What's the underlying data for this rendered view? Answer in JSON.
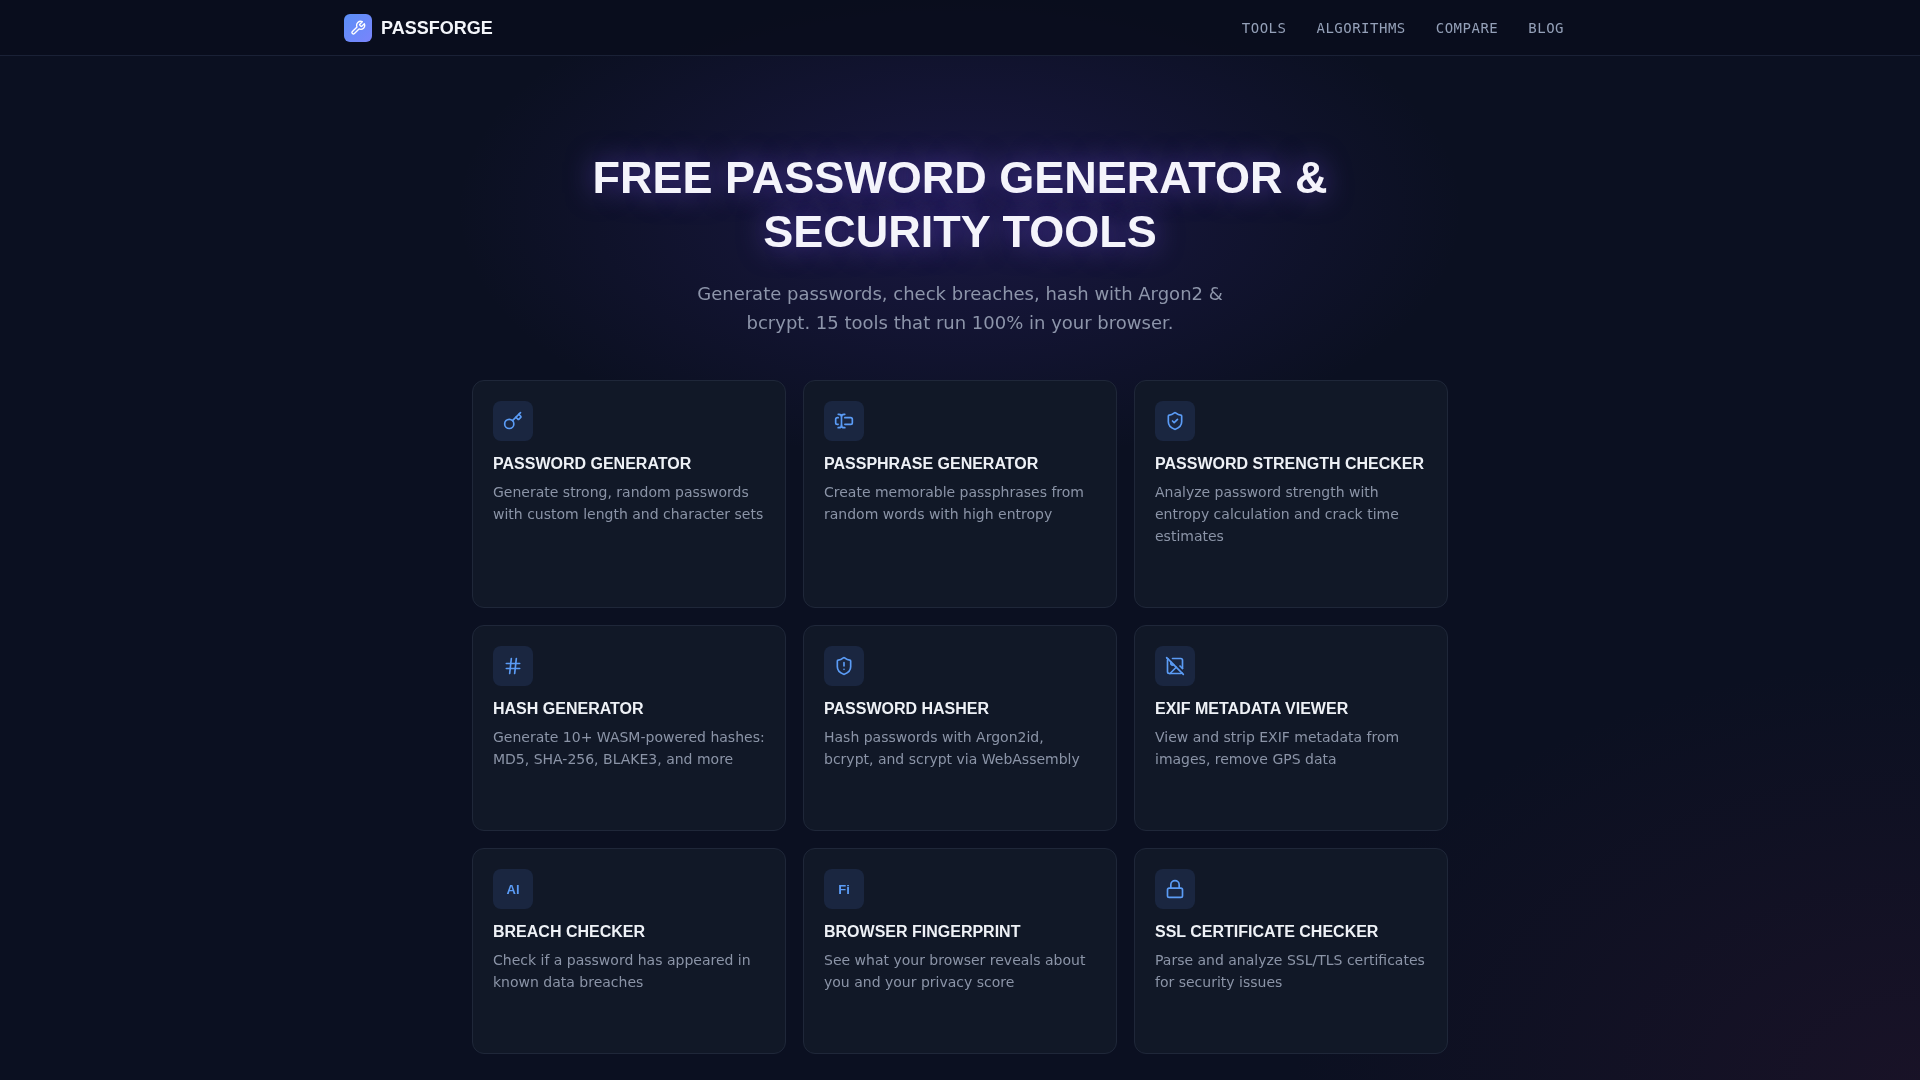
{
  "header": {
    "brand": "PASSFORGE",
    "nav": [
      "TOOLS",
      "ALGORITHMS",
      "COMPARE",
      "BLOG"
    ]
  },
  "hero": {
    "title": "FREE PASSWORD GENERATOR & SECURITY TOOLS",
    "subtitle": "Generate passwords, check breaches, hash with Argon2 & bcrypt. 15 tools that run 100% in your browser."
  },
  "tools": [
    {
      "kind": "icon",
      "title": "PASSWORD GENERATOR",
      "description": "Generate strong, random passwords with custom length and character sets"
    },
    {
      "kind": "icon",
      "title": "PASSPHRASE GENERATOR",
      "description": "Create memorable passphrases from random words with high entropy"
    },
    {
      "kind": "icon",
      "title": "PASSWORD STRENGTH CHECKER",
      "description": "Analyze password strength with entropy calculation and crack time estimates"
    },
    {
      "kind": "icon",
      "title": "HASH GENERATOR",
      "description": "Generate 10+ WASM-powered hashes: MD5, SHA-256, BLAKE3, and more"
    },
    {
      "kind": "icon",
      "title": "PASSWORD HASHER",
      "description": "Hash passwords with Argon2id, bcrypt, and scrypt via WebAssembly"
    },
    {
      "kind": "icon",
      "title": "EXIF METADATA VIEWER",
      "description": "View and strip EXIF metadata from images, remove GPS data"
    },
    {
      "kind": "initials",
      "initials": "Al",
      "title": "BREACH CHECKER",
      "description": "Check if a password has appeared in known data breaches"
    },
    {
      "kind": "initials",
      "initials": "Fi",
      "title": "BROWSER FINGERPRINT",
      "description": "See what your browser reveals about you and your privacy score"
    },
    {
      "kind": "icon",
      "title": "SSL CERTIFICATE CHECKER",
      "description": "Parse and analyze SSL/TLS certificates for security issues"
    }
  ]
}
